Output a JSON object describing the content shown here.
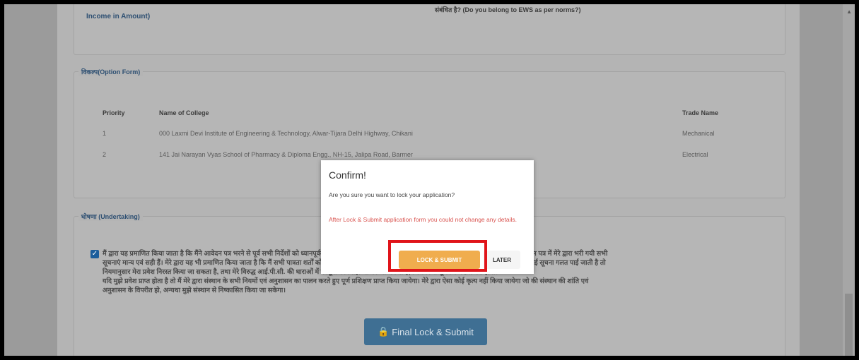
{
  "income": {
    "label": "Income in Amount)",
    "ews_question": "संबंधित है? (Do you belong to EWS as per norms?)"
  },
  "options": {
    "legend": "विकल्प(Option Form)",
    "headers": [
      "Priority",
      "Name of College",
      "Trade Name"
    ],
    "rows": [
      {
        "priority": "1",
        "college": "000 Laxmi Devi Institute of Engineering & Technology, Alwar-Tijara Delhi Highway, Chikani",
        "trade": "Mechanical"
      },
      {
        "priority": "2",
        "college": "141 Jai Narayan Vyas School of Pharmacy & Diploma Engg., NH-15, Jalipa Road, Barmer",
        "trade": "Electrical"
      }
    ]
  },
  "undertaking": {
    "legend": "घोषणा (Undertaking)",
    "lines": [
      "मैं द्वारा यह प्रमाणित किया जाता है कि मैंने आवेदन पत्र भरने से पूर्व सभी निर्देशों को ध्यानपूर्वक पढ़ लिया है तथा आवेदन पत्र में दी गई सभी सूचनाएं सत्य एवं सही हैं। ऑनलाइन आवेदन पत्र में मेरे द्वारा भरी गयी सभी",
      "सूचनाएं मान्य एवं सही हैं। मेरे द्वारा यह भी प्रमाणित किया जाता है कि मैं सभी पात्रता शर्तों को पूर्ण करता हूँ एवं मेरे द्वारा दी गई सूचना गलत पाई जाती है। भविष्य में मेरे द्वारा दी गयी कोई सूचना गलत पाई जाती है तो",
      "नियमानुसार मेरा प्रवेश निरस्त किया जा सकता है, तथा मेरे विरुद्ध आई.पी.सी. की धाराओं में कानूनी कार्यवाही भी की जा सकती है, जिसकी सम्पूर्ण जिम्मेदारी मेरी होगी।",
      "यदि मुझे प्रवेश प्राप्त होता है तो मैं मेरे द्वारा संस्थान के सभी नियमों एवं अनुशासन का पालन करते हुए पूर्ण प्रशिक्षण प्राप्त किया जायेगा। मेरे द्वारा ऐसा कोई कृत्य नहीं किया जायेगा जो की संस्थान की शांति एवं",
      "अनुशासन के विपरीत हो, अन्यथा मुझे संस्थान से निष्कासित किया जा सकेगा।"
    ]
  },
  "final_button": {
    "label": "Final Lock & Submit"
  },
  "modal": {
    "title": "Confirm!",
    "question": "Are you sure you want to lock your application?",
    "warning": "After Lock & Submit application form you could not change any details.",
    "lock_label": "LOCK & SUBMIT",
    "later_label": "LATER"
  }
}
